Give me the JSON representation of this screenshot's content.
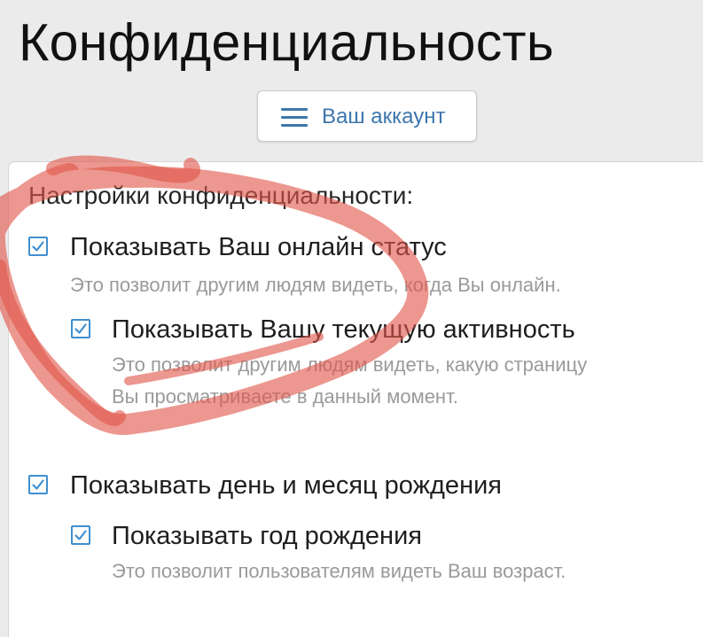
{
  "page": {
    "title": "Конфиденциальность"
  },
  "account_button": {
    "icon": "menu-icon",
    "label": "Ваш аккаунт"
  },
  "privacy": {
    "heading": "Настройки конфиденциальности:",
    "options": [
      {
        "label": "Показывать Ваш онлайн статус",
        "checked": true,
        "description": "Это позволит другим людям видеть, когда Вы онлайн."
      },
      {
        "label": "Показывать Вашу текущую активность",
        "checked": true,
        "description_line1": "Это позволит другим людям видеть, какую страницу",
        "description_line2": "Вы просматриваете в данный момент."
      },
      {
        "label": "Показывать день и месяц рождения",
        "checked": true
      },
      {
        "label": "Показывать год рождения",
        "checked": true,
        "description": "Это позволит пользователям видеть Ваш возраст."
      }
    ]
  },
  "colors": {
    "accent": "#3d76ad",
    "checkbox": "#3f8fd0",
    "annotation": "#e0574a",
    "muted_text": "#9a9a9a"
  }
}
